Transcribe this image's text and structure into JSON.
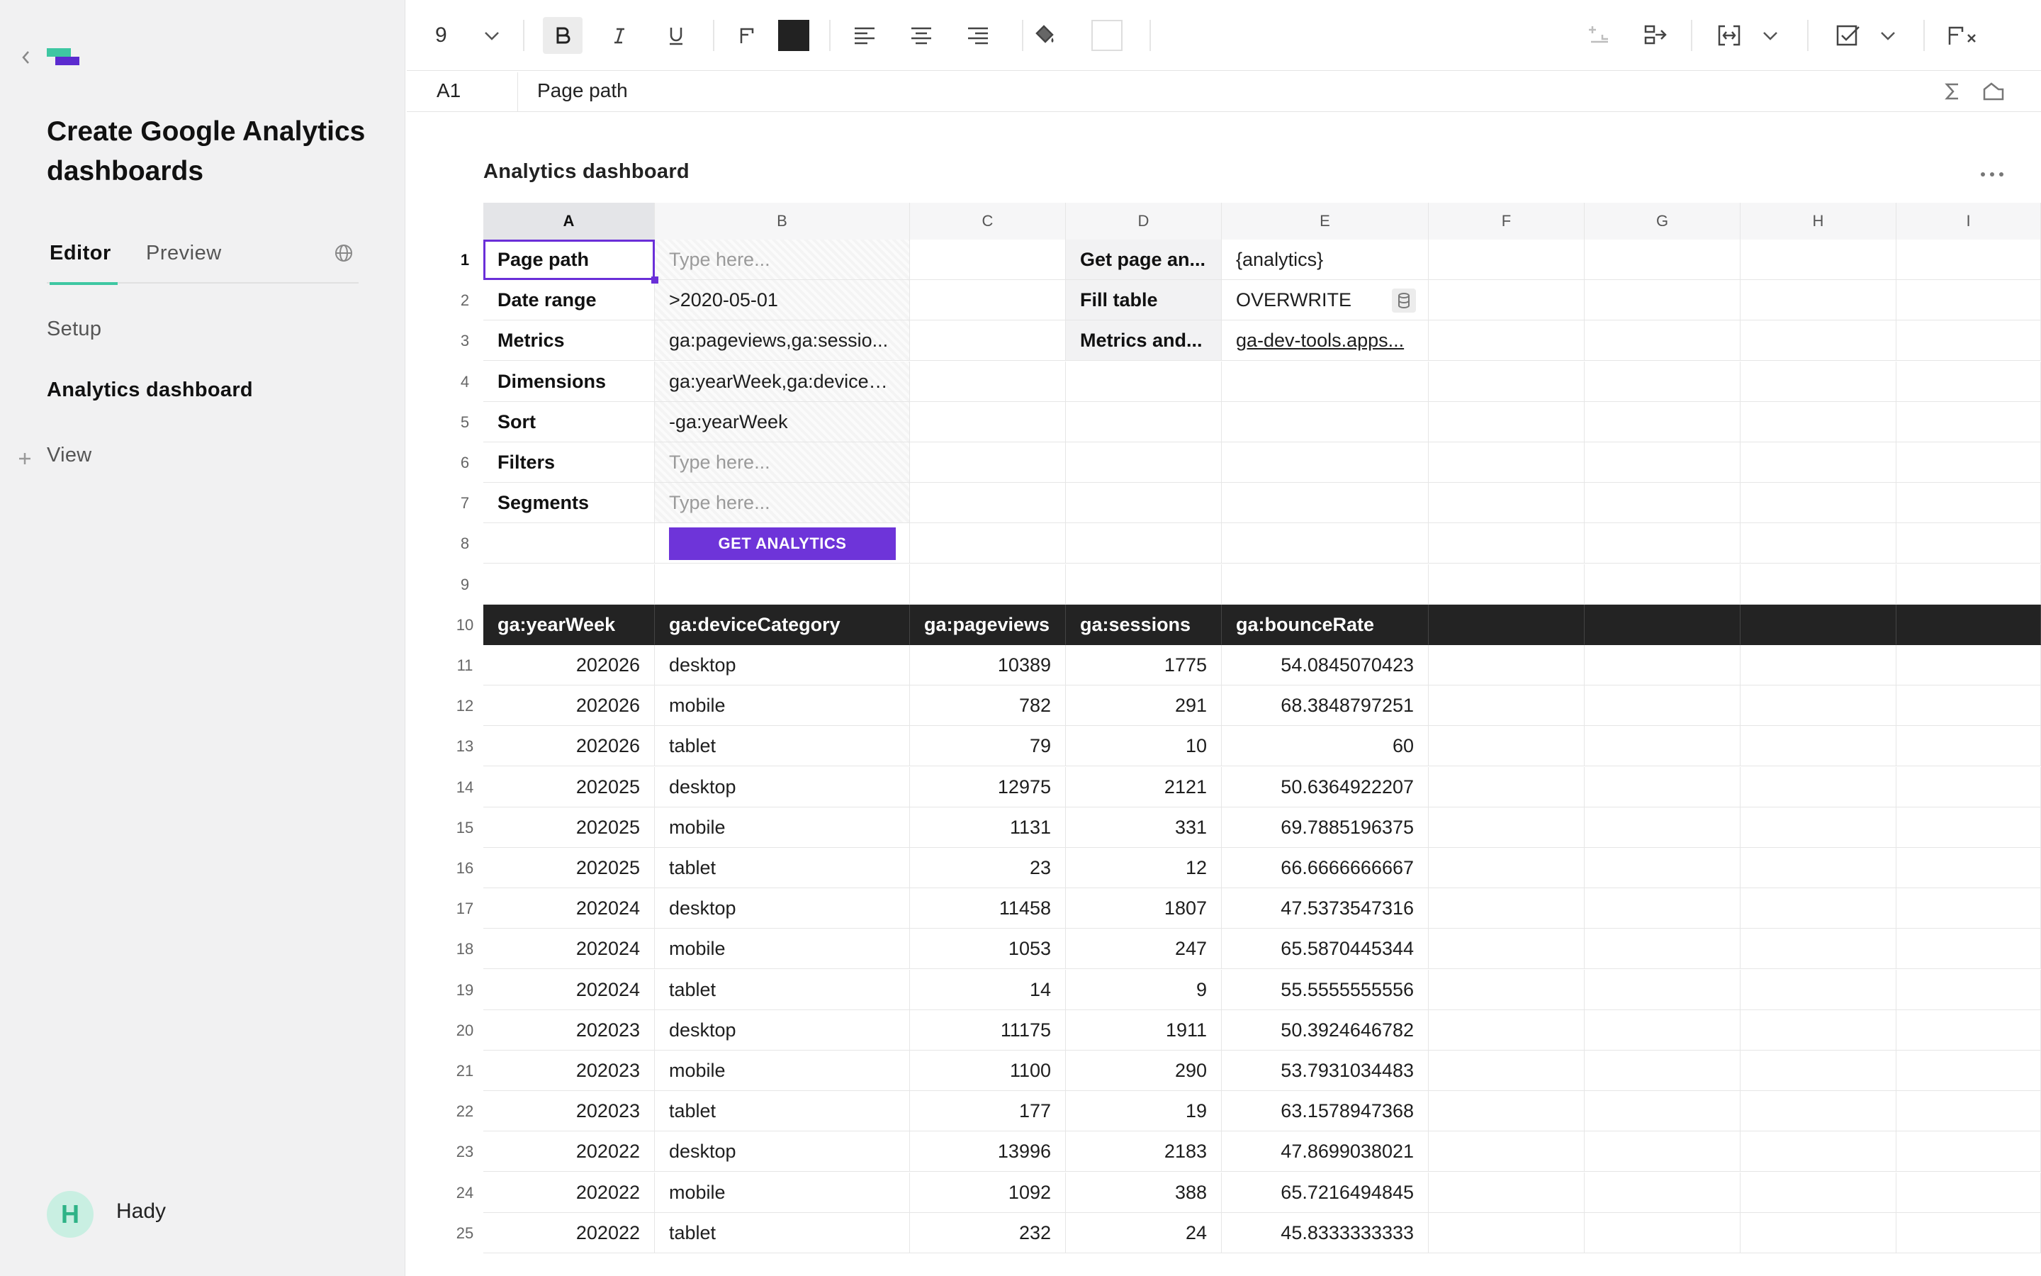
{
  "sidebar": {
    "doc_title": "Create Google Analytics dashboards",
    "tabs": [
      {
        "label": "Editor"
      },
      {
        "label": "Preview"
      }
    ],
    "nav": [
      {
        "label": "Setup"
      },
      {
        "label": "Analytics dashboard"
      }
    ],
    "add_view_label": "View",
    "user": {
      "initial": "H",
      "name": "Hady"
    }
  },
  "toolbar": {
    "font_size": "9",
    "text_color": "#222222",
    "fill_color": "#ffffff"
  },
  "formula_bar": {
    "cell_ref": "A1",
    "value": "Page path"
  },
  "sheet": {
    "title": "Analytics dashboard",
    "columns": [
      "A",
      "B",
      "C",
      "D",
      "E",
      "F",
      "G",
      "H",
      "I"
    ],
    "rows": [
      "1",
      "2",
      "3",
      "4",
      "5",
      "6",
      "7",
      "8",
      "9",
      "10",
      "11",
      "12",
      "13",
      "14",
      "15",
      "16",
      "17",
      "18",
      "19",
      "20",
      "21",
      "22",
      "23",
      "24",
      "25"
    ],
    "params": [
      {
        "label": "Page path",
        "value": "Type here..."
      },
      {
        "label": "Date range",
        "value": ">2020-05-01"
      },
      {
        "label": "Metrics",
        "value": "ga:pageviews,ga:sessio..."
      },
      {
        "label": "Dimensions",
        "value": "ga:yearWeek,ga:deviceC..."
      },
      {
        "label": "Sort",
        "value": "-ga:yearWeek"
      },
      {
        "label": "Filters",
        "value": "Type here..."
      },
      {
        "label": "Segments",
        "value": "Type here..."
      }
    ],
    "get_button": "GET ANALYTICS",
    "side_params": [
      {
        "label": "Get page an...",
        "value": "{analytics}"
      },
      {
        "label": "Fill table",
        "value": "OVERWRITE"
      },
      {
        "label": "Metrics and...",
        "value": "ga-dev-tools.apps..."
      }
    ],
    "table_headers": [
      "ga:yearWeek",
      "ga:deviceCategory",
      "ga:pageviews",
      "ga:sessions",
      "ga:bounceRate"
    ],
    "table_rows": [
      [
        "202026",
        "desktop",
        "10389",
        "1775",
        "54.0845070423"
      ],
      [
        "202026",
        "mobile",
        "782",
        "291",
        "68.3848797251"
      ],
      [
        "202026",
        "tablet",
        "79",
        "10",
        "60"
      ],
      [
        "202025",
        "desktop",
        "12975",
        "2121",
        "50.6364922207"
      ],
      [
        "202025",
        "mobile",
        "1131",
        "331",
        "69.7885196375"
      ],
      [
        "202025",
        "tablet",
        "23",
        "12",
        "66.6666666667"
      ],
      [
        "202024",
        "desktop",
        "11458",
        "1807",
        "47.5373547316"
      ],
      [
        "202024",
        "mobile",
        "1053",
        "247",
        "65.5870445344"
      ],
      [
        "202024",
        "tablet",
        "14",
        "9",
        "55.5555555556"
      ],
      [
        "202023",
        "desktop",
        "11175",
        "1911",
        "50.3924646782"
      ],
      [
        "202023",
        "mobile",
        "1100",
        "290",
        "53.7931034483"
      ],
      [
        "202023",
        "tablet",
        "177",
        "19",
        "63.1578947368"
      ],
      [
        "202022",
        "desktop",
        "13996",
        "2183",
        "47.8699038021"
      ],
      [
        "202022",
        "mobile",
        "1092",
        "388",
        "65.7216494845"
      ],
      [
        "202022",
        "tablet",
        "232",
        "24",
        "45.8333333333"
      ]
    ]
  },
  "colors": {
    "accent": "#6e34d9",
    "brand_green": "#3ec7a2",
    "header_dark": "#232323"
  }
}
